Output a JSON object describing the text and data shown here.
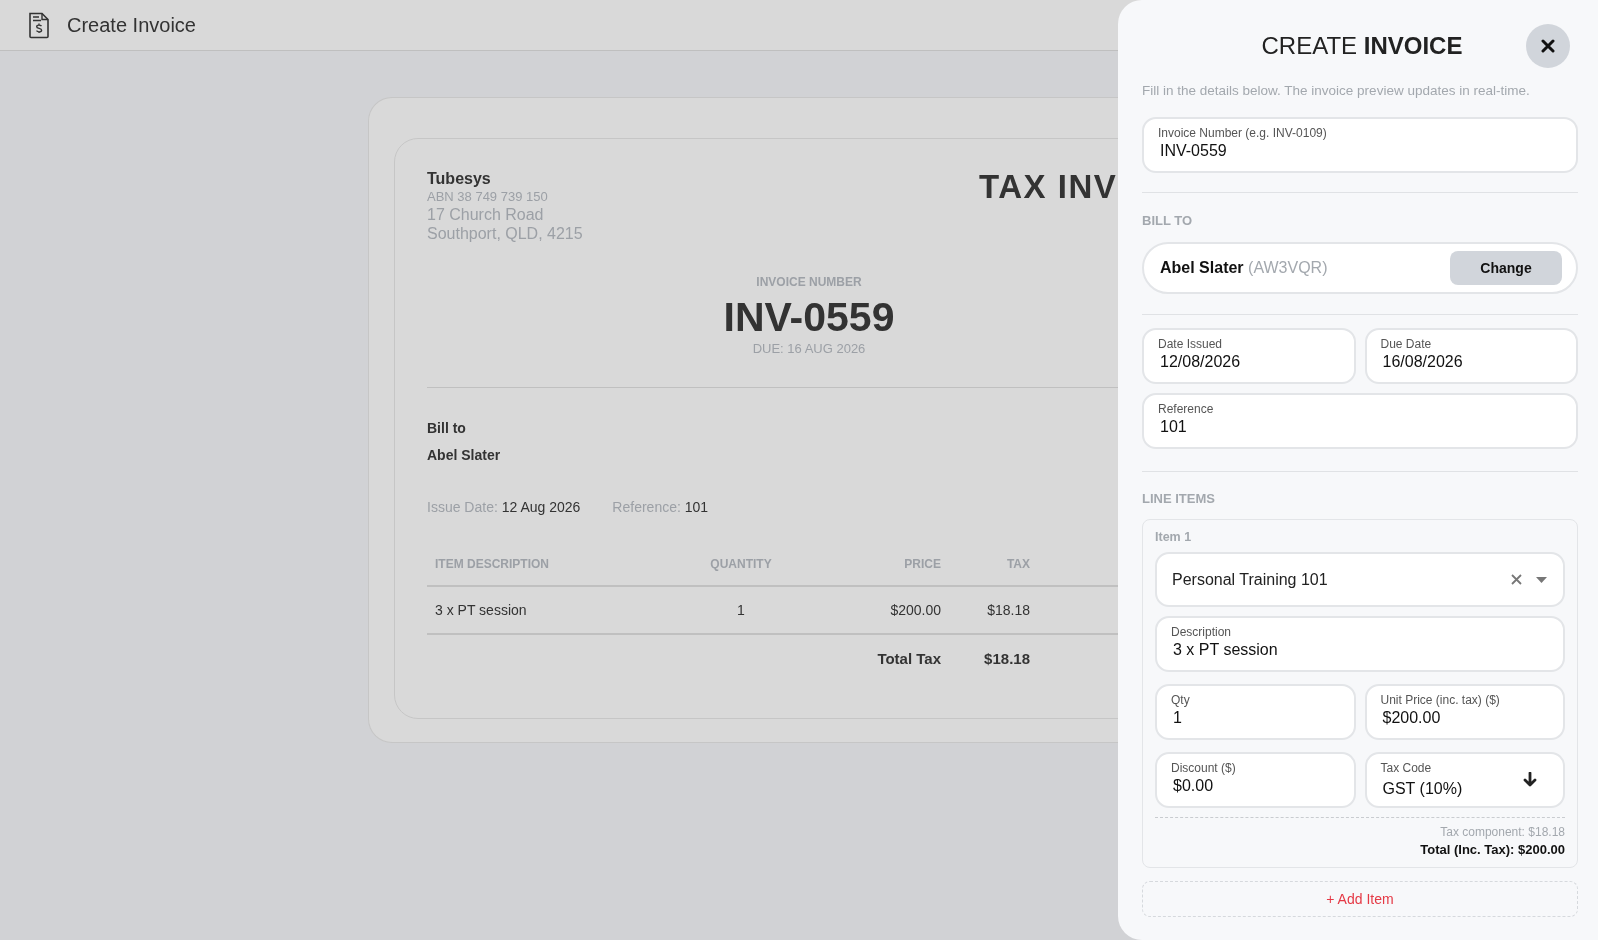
{
  "header": {
    "title": "Create Invoice"
  },
  "preview": {
    "company": {
      "name": "Tubesys",
      "abn": "ABN 38 749 739 150",
      "address_lines": [
        "17 Church Road",
        "Southport, QLD, 4215"
      ]
    },
    "doc_title": "TAX INV",
    "invoice_number_label": "INVOICE NUMBER",
    "invoice_number": "INV-0559",
    "due": "DUE: 16 AUG 2026",
    "bill_to_label": "Bill to",
    "bill_to_name": "Abel Slater",
    "meta": [
      {
        "label": "Issue Date:",
        "value": "12 Aug 2026"
      },
      {
        "label": "Reference:",
        "value": "101"
      }
    ],
    "table": {
      "columns": [
        "ITEM DESCRIPTION",
        "QUANTITY",
        "PRICE",
        "TAX"
      ],
      "rows": [
        [
          "3 x PT session",
          "1",
          "$200.00",
          "$18.18"
        ]
      ]
    },
    "total": {
      "label": "Total Tax",
      "value": "$18.18"
    }
  },
  "drawer": {
    "title": "CREATE **INVOICE**",
    "subtitle": "Fill in the details below. The invoice preview updates in real-time.",
    "invoice_number_field": {
      "label": "Invoice Number (e.g. INV-0109)",
      "value": "INV-0559"
    },
    "bill_to": {
      "heading": "BILL TO",
      "name": "Abel Slater",
      "code": "(AW3VQR)",
      "button": "Change"
    },
    "date_fields": [
      {
        "label": "Date Issued",
        "value": "12/08/2026"
      },
      {
        "label": "Due Date",
        "value": "16/08/2026"
      }
    ],
    "reference_field": {
      "label": "Reference",
      "value": "101"
    },
    "line_items_heading": "LINE ITEMS",
    "items": [
      {
        "title": "Item 1",
        "product": "Personal Training 101",
        "description": {
          "label": "Description",
          "value": "3 x PT session"
        },
        "field_rows": [
          [
            {
              "kind": "text",
              "label": "Qty",
              "value": "1"
            },
            {
              "kind": "text",
              "label": "Unit Price (inc. tax) ($)",
              "value": "$200.00"
            }
          ],
          [
            {
              "kind": "text",
              "label": "Discount ($)",
              "value": "$0.00"
            },
            {
              "kind": "select",
              "label": "Tax Code",
              "value": "GST (10%)"
            }
          ]
        ],
        "tax_component": "Tax component: $18.18",
        "total": "Total (Inc. Tax): $200.00"
      }
    ],
    "add_button": "+ Add Item"
  }
}
